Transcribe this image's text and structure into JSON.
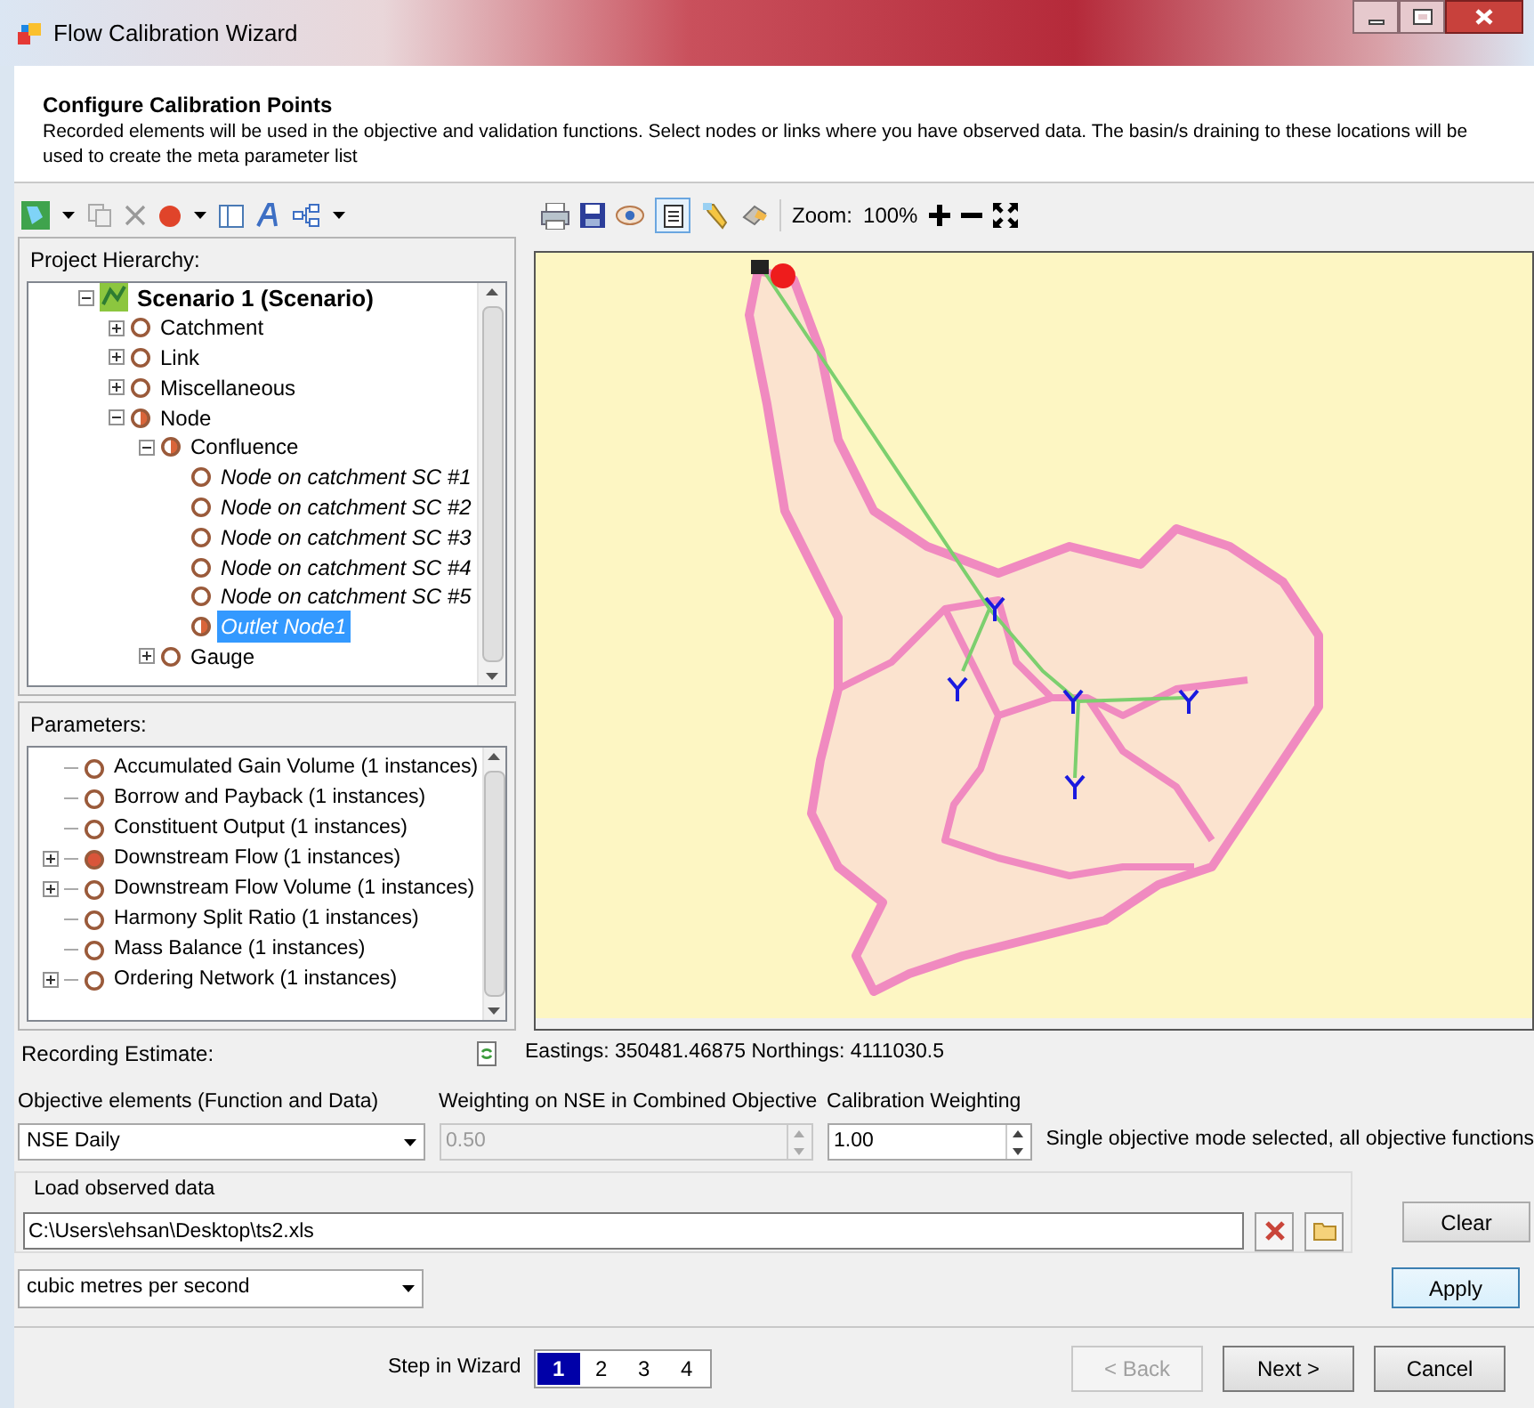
{
  "window": {
    "title": "Flow Calibration Wizard"
  },
  "header": {
    "title": "Configure Calibration Points",
    "description": "Recorded elements will be used in the objective and validation functions. Select nodes or links where you have observed data.  The basin/s draining to these locations will be used to create the meta parameter list"
  },
  "hierarchy": {
    "label": "Project Hierarchy:",
    "items": [
      {
        "label": "Scenario 1 (Scenario)",
        "kind": "scenario",
        "expanded": true,
        "selected": false,
        "children": [
          {
            "label": "Catchment",
            "kind": "category",
            "expanded": false,
            "selected": false
          },
          {
            "label": "Link",
            "kind": "category",
            "expanded": false,
            "selected": false
          },
          {
            "label": "Miscellaneous",
            "kind": "category",
            "expanded": false,
            "selected": false
          },
          {
            "label": "Node",
            "kind": "partial",
            "expanded": true,
            "selected": false,
            "children": [
              {
                "label": "Confluence",
                "kind": "partial",
                "expanded": true,
                "selected": false,
                "children": [
                  {
                    "label": "Node on catchment SC #1",
                    "kind": "instance",
                    "selected": false
                  },
                  {
                    "label": "Node on catchment SC #2",
                    "kind": "instance",
                    "selected": false
                  },
                  {
                    "label": "Node on catchment SC #3",
                    "kind": "instance",
                    "selected": false
                  },
                  {
                    "label": "Node on catchment SC #4",
                    "kind": "instance",
                    "selected": false
                  },
                  {
                    "label": "Node on catchment SC #5",
                    "kind": "instance",
                    "selected": false
                  },
                  {
                    "label": "Outlet Node1",
                    "kind": "outlet",
                    "selected": true
                  }
                ]
              },
              {
                "label": "Gauge",
                "kind": "category",
                "expanded": false,
                "selected": false
              }
            ]
          }
        ]
      }
    ]
  },
  "parameters": {
    "label": "Parameters:",
    "items": [
      {
        "label": "Accumulated Gain Volume (1 instances)",
        "recorded": false
      },
      {
        "label": "Borrow and Payback (1 instances)",
        "recorded": false
      },
      {
        "label": "Constituent Output (1 instances)",
        "recorded": false
      },
      {
        "label": "Downstream Flow (1 instances)",
        "recorded": true,
        "expanded": false
      },
      {
        "label": "Downstream Flow Volume (1 instances)",
        "recorded": false,
        "expanded": false
      },
      {
        "label": "Harmony Split Ratio (1 instances)",
        "recorded": false
      },
      {
        "label": "Mass Balance (1 instances)",
        "recorded": false
      },
      {
        "label": "Ordering Network (1 instances)",
        "recorded": false,
        "expanded": false
      }
    ]
  },
  "recording_estimate": {
    "label": "Recording Estimate:"
  },
  "map_toolbar": {
    "zoom_label": "Zoom:",
    "zoom_value": "100%"
  },
  "status": "Eastings: 350481.46875 Northings: 4111030.5",
  "objective": {
    "label": "Objective elements (Function and Data)",
    "value": "NSE Daily"
  },
  "weighting": {
    "label": "Weighting on NSE in Combined Objective",
    "value": "0.50",
    "disabled": true
  },
  "calibration_weighting": {
    "label": "Calibration Weighting",
    "value": "1.00",
    "disabled": false
  },
  "mode_message": "Single objective mode selected, all objective functions",
  "load": {
    "label": "Load observed data",
    "path": "C:\\Users\\ehsan\\Desktop\\ts2.xls"
  },
  "units": {
    "value": "cubic metres per second"
  },
  "side_buttons": [
    "Clear",
    "Apply"
  ],
  "steps": {
    "label": "Step in Wizard",
    "items": [
      {
        "label": "1",
        "selected": true
      },
      {
        "label": "2",
        "selected": false
      },
      {
        "label": "3",
        "selected": false
      },
      {
        "label": "4",
        "selected": false
      }
    ]
  },
  "nav_buttons": [
    {
      "label": "< Back",
      "disabled": true
    },
    {
      "label": "Next >",
      "disabled": false
    },
    {
      "label": "Cancel",
      "disabled": false
    }
  ]
}
